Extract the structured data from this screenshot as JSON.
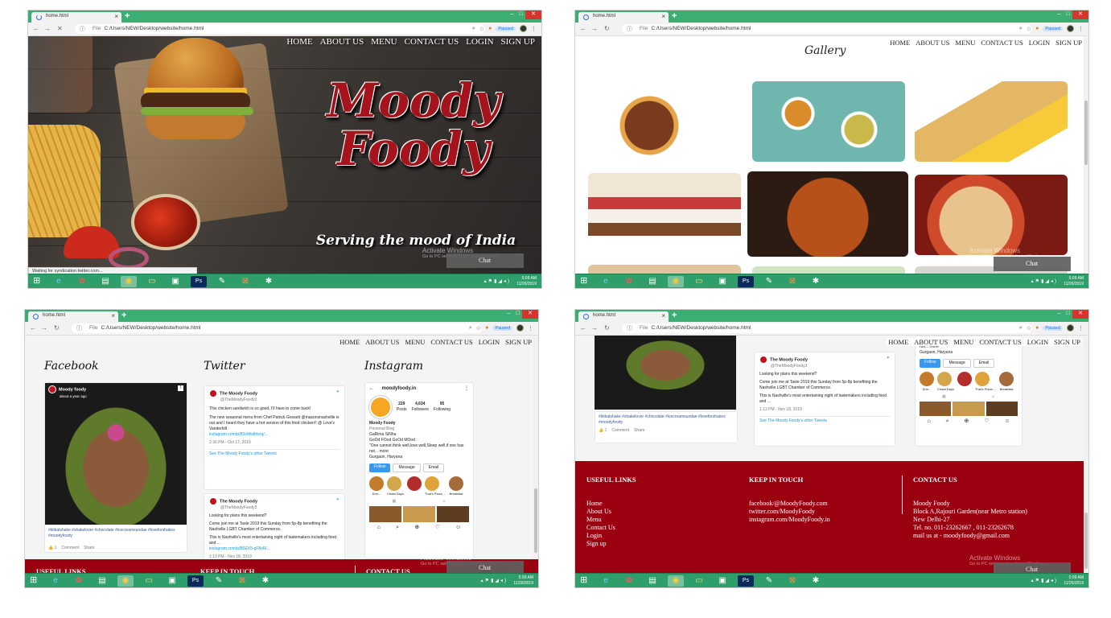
{
  "browser": {
    "tab_title": "home.html",
    "file_label": "File",
    "url": "C:/Users/NEW/Desktop/website/home.html",
    "paused_label": "Paused",
    "clock_time": "5:09 AM",
    "clock_date": "11/26/2019",
    "status_text": "Waiting for syndication.twitter.com...",
    "activate_title": "Activate Windows",
    "activate_sub": "Go to PC settings to activate Windows.",
    "chat_label": "Chat"
  },
  "nav": [
    "HOME",
    "ABOUT US",
    "MENU",
    "CONTACT US",
    "LOGIN",
    "SIGN UP"
  ],
  "hero": {
    "title_line1": "Moody",
    "title_line2": "Foody",
    "tagline": "Serving the mood of India"
  },
  "gallery": {
    "title": "Gallery"
  },
  "social": {
    "facebook_heading": "Facebook",
    "twitter_heading": "Twitter",
    "instagram_heading": "Instagram",
    "fb_page": "Moody foody",
    "fb_time": "about a year ago",
    "fb_caption": "#kitkatshake #shakelover #chocolate #icecreamsundae #loveforshakes #moodyfoody",
    "fb_actions": [
      "1",
      "Comment",
      "Share"
    ],
    "tweets": [
      {
        "name": "The Moody Foody",
        "handle": "@TheMoodyFoody3",
        "text": "This chicken sandwich is so good, I'll have to come back!",
        "text2": "The new seasonal menu from Chef Patrick Gossett @masonsnashville is out and I heard they have a hot version of this fried chicken!! @ Love's Vanderbilt",
        "link": "instagram.com/p/B3xMw8rbvq/...",
        "meta": "2:36 PM - Oct 17, 2019"
      },
      {
        "name": "The Moody Foody",
        "handle": "@TheMoodyFoody3",
        "text": "Looking for plans this weekend?",
        "text2": "Come join me at Taste 2019 this Sunday from 5p-8p benefiting the Nashville LGBT Chamber of Commerce.",
        "text3": "This is Nashville's most entertaining night of tastemakers including food and ...",
        "link": "instagram.com/p/B5EX5-gF8vR/...",
        "meta": "1:13 PM - Nov 18, 2019"
      }
    ],
    "see_more": "See The Moody Foody's other Tweets",
    "insta": {
      "username": "moodyfoody.in",
      "posts": "229",
      "posts_label": "Posts",
      "followers": "4,634",
      "followers_label": "Followers",
      "following": "95",
      "following_label": "Following",
      "name": "Moody Foody",
      "type": "Personal Blog",
      "bio1": "GaRima SiNha",
      "bio2": "GoOd FOod GoOd MOod",
      "bio3": "\"One cannot think well,love well,Sleep well,if one has not... more",
      "location": "Gurgaon, Haryana",
      "follow": "Follow",
      "message": "Message",
      "email": "Email",
      "highlights": [
        "Drin...",
        "Chaat Days",
        "",
        "That's Pizza ...",
        "Breakfast"
      ]
    }
  },
  "footer": {
    "useful_links_title": "USEFUL LINKS",
    "keep_in_touch_title": "KEEP IN TOUCH",
    "contact_title": "CONTACT US",
    "links": [
      "Home",
      "About Us",
      "Menu",
      "Contact Us",
      "Login",
      "Sign up"
    ],
    "touch": [
      "facebook/@MoodyFoody.com",
      "twitter.com/MoodyFoody",
      "instagram.com/MoodyFoody.in"
    ],
    "contact": [
      "Moody Foody",
      "Block A,Rajouri Garden(near Metro station)",
      "New Delhi-27",
      "Tel. no. 011-23262667 , 011-23262678",
      "mail us at - moodyfoody@gmail.com"
    ]
  },
  "colors": {
    "chrome_green": "#3cae74",
    "footer_red": "#9b0010",
    "taskbar": "#2e9e6a",
    "brand_red": "#a5141c"
  },
  "taskbar_icons": [
    "windows-icon",
    "ie-icon",
    "app-icon",
    "files-icon",
    "chrome-icon",
    "explorer-icon",
    "camera-icon",
    "photoshop-icon",
    "editor-icon",
    "xampp-icon",
    "paint-icon"
  ]
}
